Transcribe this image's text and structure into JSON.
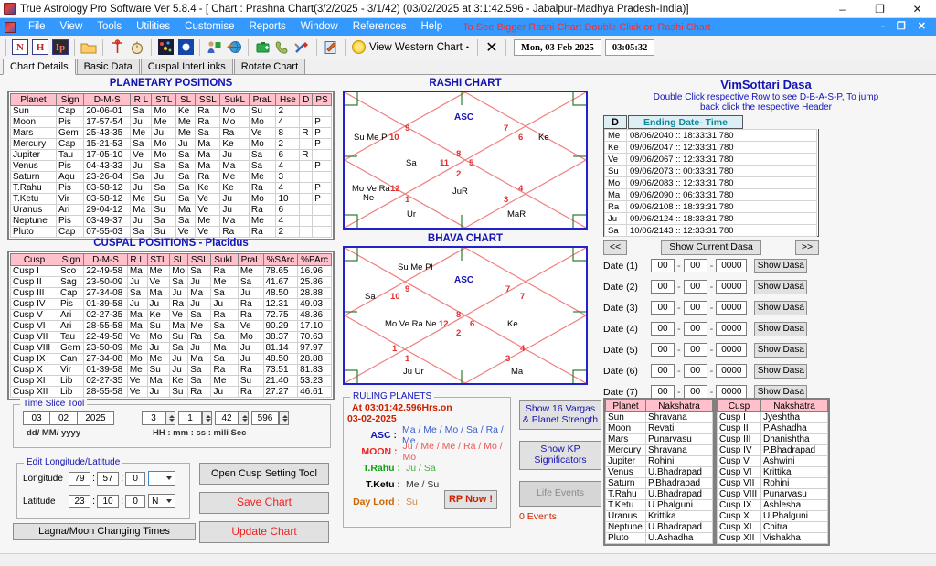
{
  "window": {
    "title": "True Astrology Pro Software Ver 5.8.4 - [ Chart : Prashna Chart(3/2/2025 - 3/1/42) (03/02/2025 at 3:1:42.596 - Jabalpur-Madhya Pradesh-India)]",
    "minimize": "–",
    "maximize": "❐",
    "close": "✕",
    "mdi_minimize": "-",
    "mdi_restore": "❐",
    "mdi_close": "✕"
  },
  "menubar": {
    "items": [
      "File",
      "View",
      "Tools",
      "Utilities",
      "Customise",
      "Reports",
      "Window",
      "References",
      "Help"
    ],
    "hint": "To See Bigger Rashi Chart Double Click on Rashi Chart",
    "hint_color": "#ff2a2a",
    "bg_color": "#3399ff"
  },
  "toolbar": {
    "icons": [
      "N",
      "H",
      "Ip",
      "open-folder-icon",
      "compass-icon",
      "stopwatch-icon",
      "stars-icon",
      "eclipse-icon",
      "person-flag-icon",
      "globe-refresh-icon",
      "briefcase-add-icon",
      "phone-icon",
      "tools-icon",
      "edit-note-icon"
    ],
    "view_western_label": "View Western Chart",
    "view_western_caret": "•",
    "cancel_icon": "✕",
    "date_display": "Mon, 03 Feb 2025",
    "time_display": "03:05:32"
  },
  "tabs": [
    {
      "label": "Chart Details",
      "active": true
    },
    {
      "label": "Basic Data",
      "active": false
    },
    {
      "label": "Cuspal InterLinks",
      "active": false
    },
    {
      "label": "Rotate Chart",
      "active": false
    }
  ],
  "planetary": {
    "title": "PLANETARY POSITIONS",
    "columns": [
      "Planet",
      "Sign",
      "D-M-S",
      "R L",
      "STL",
      "SL",
      "SSL",
      "SukL",
      "PraL",
      "Hse",
      "D",
      "PS"
    ],
    "rows": [
      [
        "Sun",
        "Cap",
        "20-06-01",
        "Sa",
        "Mo",
        "Ke",
        "Ra",
        "Mo",
        "Su",
        "2",
        "",
        ""
      ],
      [
        "Moon",
        "Pis",
        "17-57-54",
        "Ju",
        "Me",
        "Me",
        "Ra",
        "Mo",
        "Mo",
        "4",
        "",
        "P"
      ],
      [
        "Mars",
        "Gem",
        "25-43-35",
        "Me",
        "Ju",
        "Me",
        "Sa",
        "Ra",
        "Ve",
        "8",
        "R",
        "P"
      ],
      [
        "Mercury",
        "Cap",
        "15-21-53",
        "Sa",
        "Mo",
        "Ju",
        "Ma",
        "Ke",
        "Mo",
        "2",
        "",
        "P"
      ],
      [
        "Jupiter",
        "Tau",
        "17-05-10",
        "Ve",
        "Mo",
        "Sa",
        "Ma",
        "Ju",
        "Sa",
        "6",
        "R",
        ""
      ],
      [
        "Venus",
        "Pis",
        "04-43-33",
        "Ju",
        "Sa",
        "Sa",
        "Ma",
        "Ma",
        "Sa",
        "4",
        "",
        "P"
      ],
      [
        "Saturn",
        "Aqu",
        "23-26-04",
        "Sa",
        "Ju",
        "Sa",
        "Ra",
        "Me",
        "Me",
        "3",
        "",
        ""
      ],
      [
        "T.Rahu",
        "Pis",
        "03-58-12",
        "Ju",
        "Sa",
        "Sa",
        "Ke",
        "Ke",
        "Ra",
        "4",
        "",
        "P"
      ],
      [
        "T.Ketu",
        "Vir",
        "03-58-12",
        "Me",
        "Su",
        "Sa",
        "Ve",
        "Ju",
        "Mo",
        "10",
        "",
        "P"
      ],
      [
        "Uranus",
        "Ari",
        "29-04-12",
        "Ma",
        "Su",
        "Ma",
        "Ve",
        "Ju",
        "Ra",
        "6",
        "",
        ""
      ],
      [
        "Neptune",
        "Pis",
        "03-49-37",
        "Ju",
        "Sa",
        "Sa",
        "Me",
        "Ma",
        "Me",
        "4",
        "",
        ""
      ],
      [
        "Pluto",
        "Cap",
        "07-55-03",
        "Sa",
        "Su",
        "Ve",
        "Ve",
        "Ra",
        "Ra",
        "2",
        "",
        ""
      ]
    ]
  },
  "cuspal": {
    "title": "CUSPAL POSITIONS - Placidus",
    "columns": [
      "Cusp",
      "Sign",
      "D-M-S",
      "R L",
      "STL",
      "SL",
      "SSL",
      "SukL",
      "PraL",
      "%SArc",
      "%PArc"
    ],
    "rows": [
      [
        "Cusp I",
        "Sco",
        "22-49-58",
        "Ma",
        "Me",
        "Mo",
        "Sa",
        "Ra",
        "Me",
        "78.65",
        "16.96"
      ],
      [
        "Cusp II",
        "Sag",
        "23-50-09",
        "Ju",
        "Ve",
        "Sa",
        "Ju",
        "Me",
        "Sa",
        "41.67",
        "25.86"
      ],
      [
        "Cusp III",
        "Cap",
        "27-34-08",
        "Sa",
        "Ma",
        "Ju",
        "Ma",
        "Sa",
        "Ju",
        "48.50",
        "28.88"
      ],
      [
        "Cusp IV",
        "Pis",
        "01-39-58",
        "Ju",
        "Ju",
        "Ra",
        "Ju",
        "Ju",
        "Ra",
        "12.31",
        "49.03"
      ],
      [
        "Cusp V",
        "Ari",
        "02-27-35",
        "Ma",
        "Ke",
        "Ve",
        "Sa",
        "Ra",
        "Ra",
        "72.75",
        "48.36"
      ],
      [
        "Cusp VI",
        "Ari",
        "28-55-58",
        "Ma",
        "Su",
        "Ma",
        "Me",
        "Sa",
        "Ve",
        "90.29",
        "17.10"
      ],
      [
        "Cusp VII",
        "Tau",
        "22-49-58",
        "Ve",
        "Mo",
        "Su",
        "Ra",
        "Sa",
        "Mo",
        "38.37",
        "70.63"
      ],
      [
        "Cusp VIII",
        "Gem",
        "23-50-09",
        "Me",
        "Ju",
        "Sa",
        "Ju",
        "Ma",
        "Ju",
        "81.14",
        "97.97"
      ],
      [
        "Cusp IX",
        "Can",
        "27-34-08",
        "Mo",
        "Me",
        "Ju",
        "Ma",
        "Sa",
        "Ju",
        "48.50",
        "28.88"
      ],
      [
        "Cusp X",
        "Vir",
        "01-39-58",
        "Me",
        "Su",
        "Ju",
        "Sa",
        "Ra",
        "Ra",
        "73.51",
        "81.83"
      ],
      [
        "Cusp XI",
        "Lib",
        "02-27-35",
        "Ve",
        "Ma",
        "Ke",
        "Sa",
        "Me",
        "Su",
        "21.40",
        "53.23"
      ],
      [
        "Cusp XII",
        "Lib",
        "28-55-58",
        "Ve",
        "Ju",
        "Su",
        "Ra",
        "Ju",
        "Ra",
        "27.27",
        "46.61"
      ]
    ]
  },
  "rashi_chart": {
    "title": "RASHI CHART",
    "asc_label": "ASC",
    "house_numbers": [
      "1",
      "2",
      "3",
      "4",
      "5",
      "6",
      "7",
      "8",
      "9",
      "10",
      "11",
      "12"
    ],
    "placements": [
      {
        "text": "Su Me Pl",
        "pos": "left-upper"
      },
      {
        "text": "Ke",
        "pos": "right-upper"
      },
      {
        "text": "Sa",
        "pos": "center-left-upper"
      },
      {
        "text": "Mo Ve Ra",
        "pos": "left-lower-1"
      },
      {
        "text": "Ne",
        "pos": "left-lower-2"
      },
      {
        "text": "JuR",
        "pos": "center-lower"
      },
      {
        "text": "Ur",
        "pos": "bottom-left"
      },
      {
        "text": "MaR",
        "pos": "bottom-right"
      }
    ]
  },
  "bhava_chart": {
    "title": "BHAVA CHART",
    "asc_label": "ASC",
    "house_numbers": [
      "1",
      "1",
      "2",
      "3",
      "4",
      "6",
      "7",
      "7",
      "8",
      "9",
      "10",
      "12"
    ],
    "placements": [
      {
        "text": "Su Me Pl",
        "pos": "top-center"
      },
      {
        "text": "Sa",
        "pos": "left-upper"
      },
      {
        "text": "Mo Ve Ra Ne",
        "pos": "center-left"
      },
      {
        "text": "Ke",
        "pos": "center-right"
      },
      {
        "text": "Ju Ur",
        "pos": "bottom-left"
      },
      {
        "text": "Ma",
        "pos": "bottom-right"
      }
    ]
  },
  "ruling_planets": {
    "legend": "RULING PLANETS",
    "time_line": "At 03:01:42.596Hrs.on",
    "date_line": "03-02-2025",
    "rows": [
      {
        "label": "ASC :",
        "value": "Ma / Me / Mo / Sa / Ra / Me",
        "label_color": "#1414b4",
        "value_color": "#3a5fd0"
      },
      {
        "label": "MOON :",
        "value": "Ju / Me / Me / Ra / Mo / Mo",
        "label_color": "#ee2222",
        "value_color": "#ee5555"
      },
      {
        "label": "T.Rahu :",
        "value": "Ju / Sa",
        "label_color": "#10a010",
        "value_color": "#40b040"
      },
      {
        "label": "T.Ketu :",
        "value": "Me / Su",
        "label_color": "#000000",
        "value_color": "#333333"
      },
      {
        "label": "Day Lord :",
        "value": "Su",
        "label_color": "#cc6600",
        "value_color": "#cc8844"
      }
    ],
    "rp_now_button": "RP Now !"
  },
  "mid_buttons": {
    "vargas": "Show 16 Vargas\n& Planet Strength",
    "vargas_l1": "Show 16 Vargas",
    "vargas_l2": "& Planet Strength",
    "kp_l1": "Show KP",
    "kp_l2": "Significators",
    "life_events": "Life Events",
    "events_count": "0 Events"
  },
  "dasa": {
    "title": "VimSottari Dasa",
    "subtitle_l1": "Double Click respective Row to see D-B-A-S-P, To jump",
    "subtitle_l2": "back click the respective Header",
    "col_d": "D",
    "col_ending": "Ending Date- Time",
    "rows": [
      {
        "d": "Me",
        "ending": "08/06/2040 :: 18:33:31.780"
      },
      {
        "d": "Ke",
        "ending": "09/06/2047 :: 12:33:31.780"
      },
      {
        "d": "Ve",
        "ending": "09/06/2067 :: 12:33:31.780"
      },
      {
        "d": "Su",
        "ending": "09/06/2073 :: 00:33:31.780"
      },
      {
        "d": "Mo",
        "ending": "09/06/2083 :: 12:33:31.780"
      },
      {
        "d": "Ma",
        "ending": "09/06/2090 :: 06:33:31.780"
      },
      {
        "d": "Ra",
        "ending": "09/06/2108 :: 18:33:31.780"
      },
      {
        "d": "Ju",
        "ending": "09/06/2124 :: 18:33:31.780"
      },
      {
        "d": "Sa",
        "ending": "10/06/2143 :: 12:33:31.780"
      }
    ],
    "prev_button": "<<",
    "current_button": "Show Current Dasa",
    "next_button": ">>"
  },
  "date_rows": {
    "show_dasa_label": "Show Dasa",
    "separator": "-",
    "items": [
      {
        "label": "Date (1)",
        "dd": "00",
        "mm": "00",
        "yyyy": "0000"
      },
      {
        "label": "Date (2)",
        "dd": "00",
        "mm": "00",
        "yyyy": "0000"
      },
      {
        "label": "Date (3)",
        "dd": "00",
        "mm": "00",
        "yyyy": "0000"
      },
      {
        "label": "Date (4)",
        "dd": "00",
        "mm": "00",
        "yyyy": "0000"
      },
      {
        "label": "Date (5)",
        "dd": "00",
        "mm": "00",
        "yyyy": "0000"
      },
      {
        "label": "Date (6)",
        "dd": "00",
        "mm": "00",
        "yyyy": "0000"
      },
      {
        "label": "Date (7)",
        "dd": "00",
        "mm": "00",
        "yyyy": "0000"
      }
    ]
  },
  "planet_nakshatra": {
    "columns": [
      "Planet",
      "Nakshatra"
    ],
    "rows": [
      [
        "Sun",
        "Shravana"
      ],
      [
        "Moon",
        "Revati"
      ],
      [
        "Mars",
        "Punarvasu"
      ],
      [
        "Mercury",
        "Shravana"
      ],
      [
        "Jupiter",
        "Rohini"
      ],
      [
        "Venus",
        "U.Bhadrapad"
      ],
      [
        "Saturn",
        "P.Bhadrapad"
      ],
      [
        "T.Rahu",
        "U.Bhadrapad"
      ],
      [
        "T.Ketu",
        "U.Phalguni"
      ],
      [
        "Uranus",
        "Krittika"
      ],
      [
        "Neptune",
        "U.Bhadrapad"
      ],
      [
        "Pluto",
        "U.Ashadha"
      ]
    ]
  },
  "cusp_nakshatra": {
    "columns": [
      "Cusp",
      "Nakshatra"
    ],
    "rows": [
      [
        "Cusp I",
        "Jyeshtha"
      ],
      [
        "Cusp II",
        "P.Ashadha"
      ],
      [
        "Cusp III",
        "Dhanishtha"
      ],
      [
        "Cusp IV",
        "P.Bhadrapad"
      ],
      [
        "Cusp V",
        "Ashwini"
      ],
      [
        "Cusp VI",
        "Krittika"
      ],
      [
        "Cusp VII",
        "Rohini"
      ],
      [
        "Cusp VIII",
        "Punarvasu"
      ],
      [
        "Cusp IX",
        "Ashlesha"
      ],
      [
        "Cusp X",
        "U.Phalguni"
      ],
      [
        "Cusp XI",
        "Chitra"
      ],
      [
        "Cusp XII",
        "Vishakha"
      ]
    ]
  },
  "time_slice": {
    "legend": "Time Slice Tool",
    "dd": "03",
    "mm": "02",
    "yyyy": "2025",
    "date_format_label": "dd/ MM/ yyyy",
    "hh": "3",
    "min": "1",
    "ss": "42",
    "ms": "596",
    "time_format_label": "HH : mm : ss : mili Sec"
  },
  "lonlat": {
    "legend": "Edit Longitude/Latitude",
    "longitude_label": "Longitude",
    "lon_deg": "79",
    "lon_min": "57",
    "lon_sec": "0",
    "lon_dir": "",
    "latitude_label": "Latitude",
    "lat_deg": "23",
    "lat_min": "10",
    "lat_sec": "0",
    "lat_dir": "N",
    "colon": ":"
  },
  "bottom_buttons": {
    "lagna_moon": "Lagna/Moon Changing Times",
    "open_cusp": "Open Cusp Setting Tool",
    "save_chart": "Save Chart",
    "update_chart": "Update Chart"
  }
}
